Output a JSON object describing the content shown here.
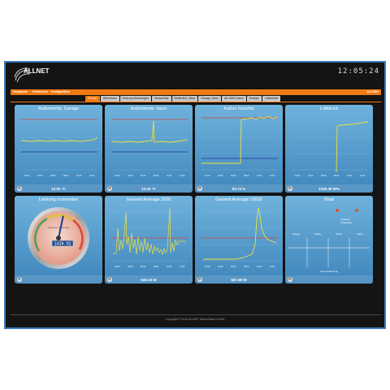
{
  "header": {
    "brand": "ALLNET",
    "clock": "12:05:24"
  },
  "menu": {
    "left": [
      "Hauptseite",
      "Funktionen",
      "Konfiguration"
    ],
    "right": "ALL3500"
  },
  "tabs": [
    {
      "label": "Fenster",
      "active": true
    },
    {
      "label": "Wohnhaus",
      "active": false
    },
    {
      "label": "Heizung Wohnungen",
      "active": false
    },
    {
      "label": "Sensorliste",
      "active": false
    },
    {
      "label": "Wetterlink_Haus",
      "active": false
    },
    {
      "label": "Garage_Haus",
      "active": false
    },
    {
      "label": "ALL3500 intern",
      "active": false
    },
    {
      "label": "Energie",
      "active": false
    },
    {
      "label": "Lüftwichtin",
      "active": false
    }
  ],
  "widgets": [
    {
      "title": "Außentemp. Garage",
      "value": "12.91 °C"
    },
    {
      "title": "Außentemp. Haus",
      "value": "12.04 °C"
    },
    {
      "title": "Außen Feuchte",
      "value": "93.73 %"
    },
    {
      "title": "Luftdruck",
      "value": "1030.38 kPa"
    },
    {
      "title": "Leistung momentan",
      "value": ""
    },
    {
      "title": "Gesamt Average 2500",
      "value": "530.15 W"
    },
    {
      "title": "Gesamt Average 10000",
      "value": "667.88 W"
    },
    {
      "title": "Waal",
      "value": ""
    }
  ],
  "gauge": {
    "label": "Leistung momentan",
    "readout": "1430.92",
    "level": 0.55
  },
  "waal": {
    "indicators": [
      "Luftdruck",
      "Luftfeuchte"
    ],
    "columns": [
      "Morgen",
      "Mittag",
      "Abend",
      "Nacht"
    ],
    "footer": "Openweathermap"
  },
  "x_ticks": [
    "02:00",
    "04:00",
    "06:00",
    "08:00",
    "10:00",
    "12:00"
  ],
  "copyright": "Copyright © 2015 ALLNET Deutschland GmbH",
  "colors": {
    "accent": "#ef7a12",
    "line": "#f3e23a",
    "limit_high": "#d8433a",
    "limit_low": "#1f2f9e"
  }
}
